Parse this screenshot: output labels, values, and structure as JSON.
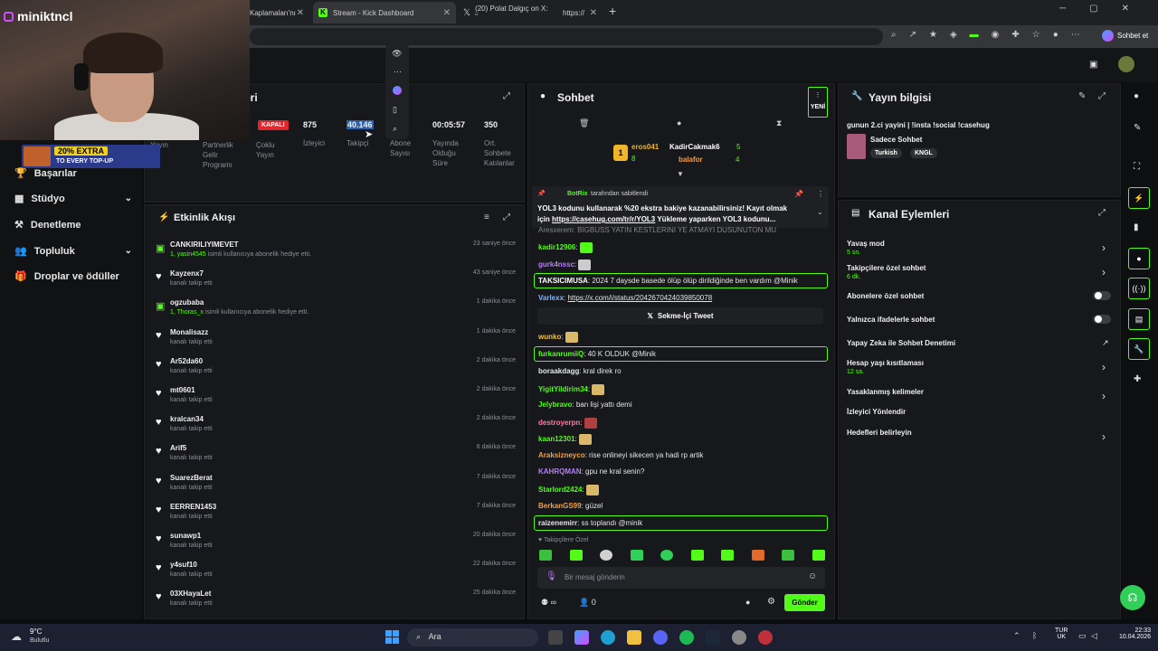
{
  "browser": {
    "tabs": [
      {
        "label": "Kaplamaları'nı"
      },
      {
        "label": "Stream - Kick Dashboard"
      },
      {
        "label": "(20) Polat Dalgıç on X: \""
      },
      {
        "label": "https://"
      }
    ],
    "new_tab": "+",
    "profile_label": "Sohbet et"
  },
  "webcam": {
    "username": "miniktncl"
  },
  "promo_banner": {
    "line1": "20% EXTRA",
    "line2": "TO EVERY TOP-UP"
  },
  "sidebar": {
    "items": [
      {
        "label": "Başarılar"
      },
      {
        "label": "Stüdyo"
      },
      {
        "label": "Denetleme"
      },
      {
        "label": "Topluluk"
      },
      {
        "label": "Droplar ve ödüller"
      }
    ]
  },
  "stats": {
    "title_suffix": "eri",
    "status_badge": "KAPALI",
    "items": [
      {
        "value": "",
        "label": "Yayın"
      },
      {
        "value": "",
        "label": "Partnerlik Gelir Programı"
      },
      {
        "value": "",
        "label": "Çoklu Yayın"
      },
      {
        "value": "875",
        "label": "İzleyici"
      },
      {
        "value": "40.146",
        "label": "Takipçi"
      },
      {
        "value": "",
        "label": "Abone Sayısı"
      },
      {
        "value": "00:05:57",
        "label": "Yayında Olduğu Süre"
      },
      {
        "value": "350",
        "label": "Ort. Sohbete Katılanlar"
      }
    ]
  },
  "activity": {
    "title": "Etkinlik Akışı",
    "events": [
      {
        "name": "CANKIRILIYIMEVET",
        "sub_user": "1, yasin4545",
        "sub": "isimli kullanıcıya abonelik hediye etti.",
        "time": "23 saniye önce",
        "gift": true
      },
      {
        "name": "Kayzenx7",
        "sub_user": "",
        "sub": "kanalı takip etti",
        "time": "43 saniye önce",
        "gift": false
      },
      {
        "name": "ogzubaba",
        "sub_user": "1, Thoras_x",
        "sub": "isimli kullanıcıya abonelik hediye etti.",
        "time": "1 dakika önce",
        "gift": true
      },
      {
        "name": "Monalisazz",
        "sub_user": "",
        "sub": "kanalı takip etti",
        "time": "1 dakika önce",
        "gift": false
      },
      {
        "name": "Ar52da60",
        "sub_user": "",
        "sub": "kanalı takip etti",
        "time": "2 dakika önce",
        "gift": false
      },
      {
        "name": "mt0601",
        "sub_user": "",
        "sub": "kanalı takip etti",
        "time": "2 dakika önce",
        "gift": false
      },
      {
        "name": "kralcan34",
        "sub_user": "",
        "sub": "kanalı takip etti",
        "time": "2 dakika önce",
        "gift": false
      },
      {
        "name": "Arif5",
        "sub_user": "",
        "sub": "kanalı takip etti",
        "time": "6 dakika önce",
        "gift": false
      },
      {
        "name": "SuarezBerat",
        "sub_user": "",
        "sub": "kanalı takip etti",
        "time": "7 dakika önce",
        "gift": false
      },
      {
        "name": "EERREN1453",
        "sub_user": "",
        "sub": "kanalı takip etti",
        "time": "7 dakika önce",
        "gift": false
      },
      {
        "name": "sunawp1",
        "sub_user": "",
        "sub": "kanalı takip etti",
        "time": "20 dakika önce",
        "gift": false
      },
      {
        "name": "y4suf10",
        "sub_user": "",
        "sub": "kanalı takip etti",
        "time": "22 dakika önce",
        "gift": false
      },
      {
        "name": "03XHayaLet",
        "sub_user": "",
        "sub": "kanalı takip etti",
        "time": "25 dakika önce",
        "gift": false
      }
    ]
  },
  "chat": {
    "title": "Sohbet",
    "new_badge": "YENİ",
    "leaders": [
      {
        "name": "eros041",
        "count": "8"
      },
      {
        "name": "KadirCakmak6",
        "count": "5"
      },
      {
        "name": "balafor",
        "count": "4"
      }
    ],
    "pinned": {
      "by": "BotRix",
      "by_suffix": "tarafından sabitlendi",
      "text1": "YOL3 kodunu kullanarak %20 ekstra bakiye kazanabilirsiniz! Kayıt olmak",
      "text2_prefix": "için",
      "link": "https://casehug.com/tr/r/YOL3",
      "text2_suffix": "Yükleme yaparken YOL3 kodunu..."
    },
    "cut_line": "Aresxerem: BIGBUSS YATIN KESTLERINI YE ATMAYI DUSUNUTON MU",
    "messages": [
      {
        "user": "kadir12906",
        "text": "",
        "color": "#53fc18"
      },
      {
        "user": "gurk4nssc",
        "text": "",
        "color": "#b77cff"
      },
      {
        "user": "TAKSICIMUSA",
        "text": "2024 7 daysde basede ölüp ölüp dirildiğinde ben vardım @Minik",
        "color": "#ffffff"
      },
      {
        "user": "Varlexx",
        "text": "https://x.com/i/status/2042670424039850078",
        "color": "#7fb5ff"
      },
      {
        "user": "wunko",
        "text": "",
        "color": "#f0c040"
      },
      {
        "user": "furkanrumiiQ",
        "text": "40 K OLDUK @Minik",
        "color": "#53fc18"
      },
      {
        "user": "boraakdagg",
        "text": "kral direk ro",
        "color": "#e6e6e6"
      },
      {
        "user": "YigitYildirim34",
        "text": "",
        "color": "#53fc18"
      },
      {
        "user": "Jelybravo",
        "text": "ban lişi yattı demi",
        "color": "#53fc18"
      },
      {
        "user": "destroyerpn",
        "text": "",
        "color": "#ff7aa0"
      },
      {
        "user": "kaan12301",
        "text": "",
        "color": "#53fc18"
      },
      {
        "user": "Araksizneyco",
        "text": "rise onlineyi sikecen ya hadi rp artik",
        "color": "#f0a040"
      },
      {
        "user": "KAHRQMAN",
        "text": "gpu ne kral senin?",
        "color": "#b77cff"
      },
      {
        "user": "Starlord2424",
        "text": "",
        "color": "#53fc18"
      },
      {
        "user": "BerkanGS99",
        "text": "güzel",
        "color": "#f0a040"
      },
      {
        "user": "raizenemirr",
        "text": "ss toplandı @minik",
        "color": "#e6e6e6"
      }
    ],
    "tweet_embed": "Sekme-İçi Tweet",
    "followers_only": "Takipçilere Özel",
    "input_placeholder": "Bir mesaj gönderin",
    "viewer_count": "0",
    "send_button": "Gönder"
  },
  "stream_info": {
    "title": "Yayın bilgisi",
    "stream_title": "gunun 2.ci yayini | !insta !social !casehug",
    "category": "Sadece Sohbet",
    "tags": [
      "Turkish",
      "KNGL"
    ]
  },
  "channel_actions": {
    "title": "Kanal Eylemleri",
    "items": [
      {
        "label": "Yavaş mod",
        "sub": "5 sn.",
        "control": "chevron"
      },
      {
        "label": "Takipçilere özel sohbet",
        "sub": "6 dk.",
        "control": "chevron"
      },
      {
        "label": "Abonelere özel sohbet",
        "sub": "",
        "control": "toggle"
      },
      {
        "label": "Yalnızca ifadelerle sohbet",
        "sub": "",
        "control": "toggle"
      },
      {
        "label": "Yapay Zeka ile Sohbet Denetimi",
        "sub": "",
        "control": "external"
      },
      {
        "label": "Hesap yaşı kısıtlaması",
        "sub": "12 sa.",
        "control": "chevron"
      },
      {
        "label": "Yasaklanmış kelimeler",
        "sub": "",
        "control": "chevron"
      },
      {
        "label": "İzleyici Yönlendir",
        "sub": "",
        "control": "none"
      },
      {
        "label": "Hedefleri belirleyin",
        "sub": "",
        "control": "chevron"
      }
    ]
  },
  "taskbar": {
    "weather_temp": "9°C",
    "weather_desc": "Bulutlu",
    "search": "Ara",
    "lang1": "TUR",
    "lang2": "UK",
    "time": "22:33",
    "date": "10.04.2026"
  },
  "colors": {
    "accent": "#53fc18",
    "panel": "#17181b",
    "background": "#0b0c0e"
  }
}
